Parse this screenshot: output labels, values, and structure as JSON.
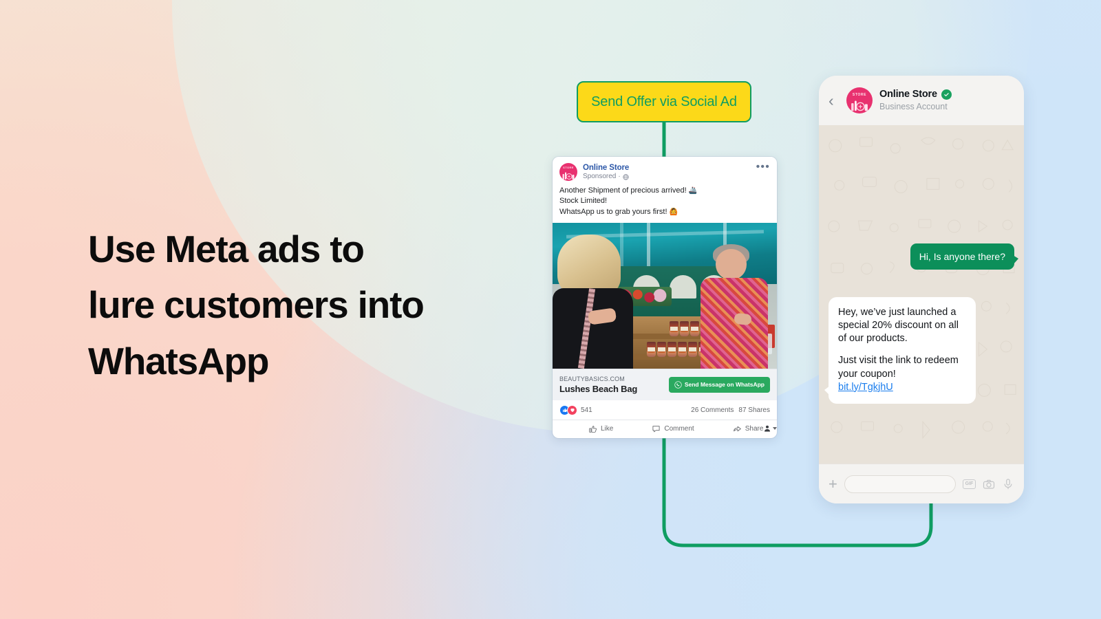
{
  "headline": {
    "line1": "Use Meta ads to",
    "line2": "lure customers into",
    "line3": "WhatsApp"
  },
  "cta_chip": {
    "label": "Send Offer via Social Ad",
    "fill": "#FCD919",
    "border": "#0f9d62",
    "text_color": "#0f9d62"
  },
  "connector": {
    "color": "#0f9d62"
  },
  "facebook_ad": {
    "page_name": "Online Store",
    "sponsored_label": "Sponsored",
    "separator": "·",
    "globe_icon": "globe-icon",
    "menu_icon": "more-options-icon",
    "copy_line1": "Another Shipment of precious arrived!",
    "copy_emoji1": "🚢",
    "copy_line2": "Stock Limited!",
    "copy_line3": "WhatsApp us to grab yours first!",
    "copy_emoji3": "🙆",
    "media_alt": "market-stall-photo",
    "link_domain": "BEAUTYBASICS.COM",
    "link_title": "Lushes Beach Bag",
    "cta_button": "Send Message on WhatsApp",
    "cta_button_color": "#2aa95f",
    "cta_icon": "whatsapp-icon",
    "reactions": {
      "like_icon": "thumbs-up-icon",
      "love_icon": "heart-icon",
      "count": "541"
    },
    "comments": "26 Comments",
    "shares": "87 Shares",
    "actions": [
      {
        "label": "Like",
        "icon": "thumbs-up-icon"
      },
      {
        "label": "Comment",
        "icon": "comment-icon"
      },
      {
        "label": "Share",
        "icon": "share-icon"
      }
    ],
    "profile_chip_icon": "profile-icon"
  },
  "whatsapp": {
    "back_icon": "back-chevron-icon",
    "avatar_label": "STORE",
    "contact_name": "Online Store",
    "verified_icon": "verified-badge-icon",
    "account_type": "Business Account",
    "messages": [
      {
        "direction": "outgoing",
        "text": "Hi, Is anyone there?"
      },
      {
        "direction": "incoming",
        "paragraph1": "Hey, we’ve just launched a special 20% discount on all of our products.",
        "paragraph2": "Just visit the link to redeem your coupon!",
        "link": "bit.ly/TgkjhU"
      }
    ],
    "composer": {
      "plus_icon": "plus-icon",
      "input_placeholder": "",
      "gif_label": "GIF",
      "camera_icon": "camera-icon",
      "mic_icon": "microphone-icon"
    },
    "bubble_out_color": "#0c8f5a",
    "bubble_in_color": "#ffffff",
    "link_color": "#1a7ded"
  }
}
